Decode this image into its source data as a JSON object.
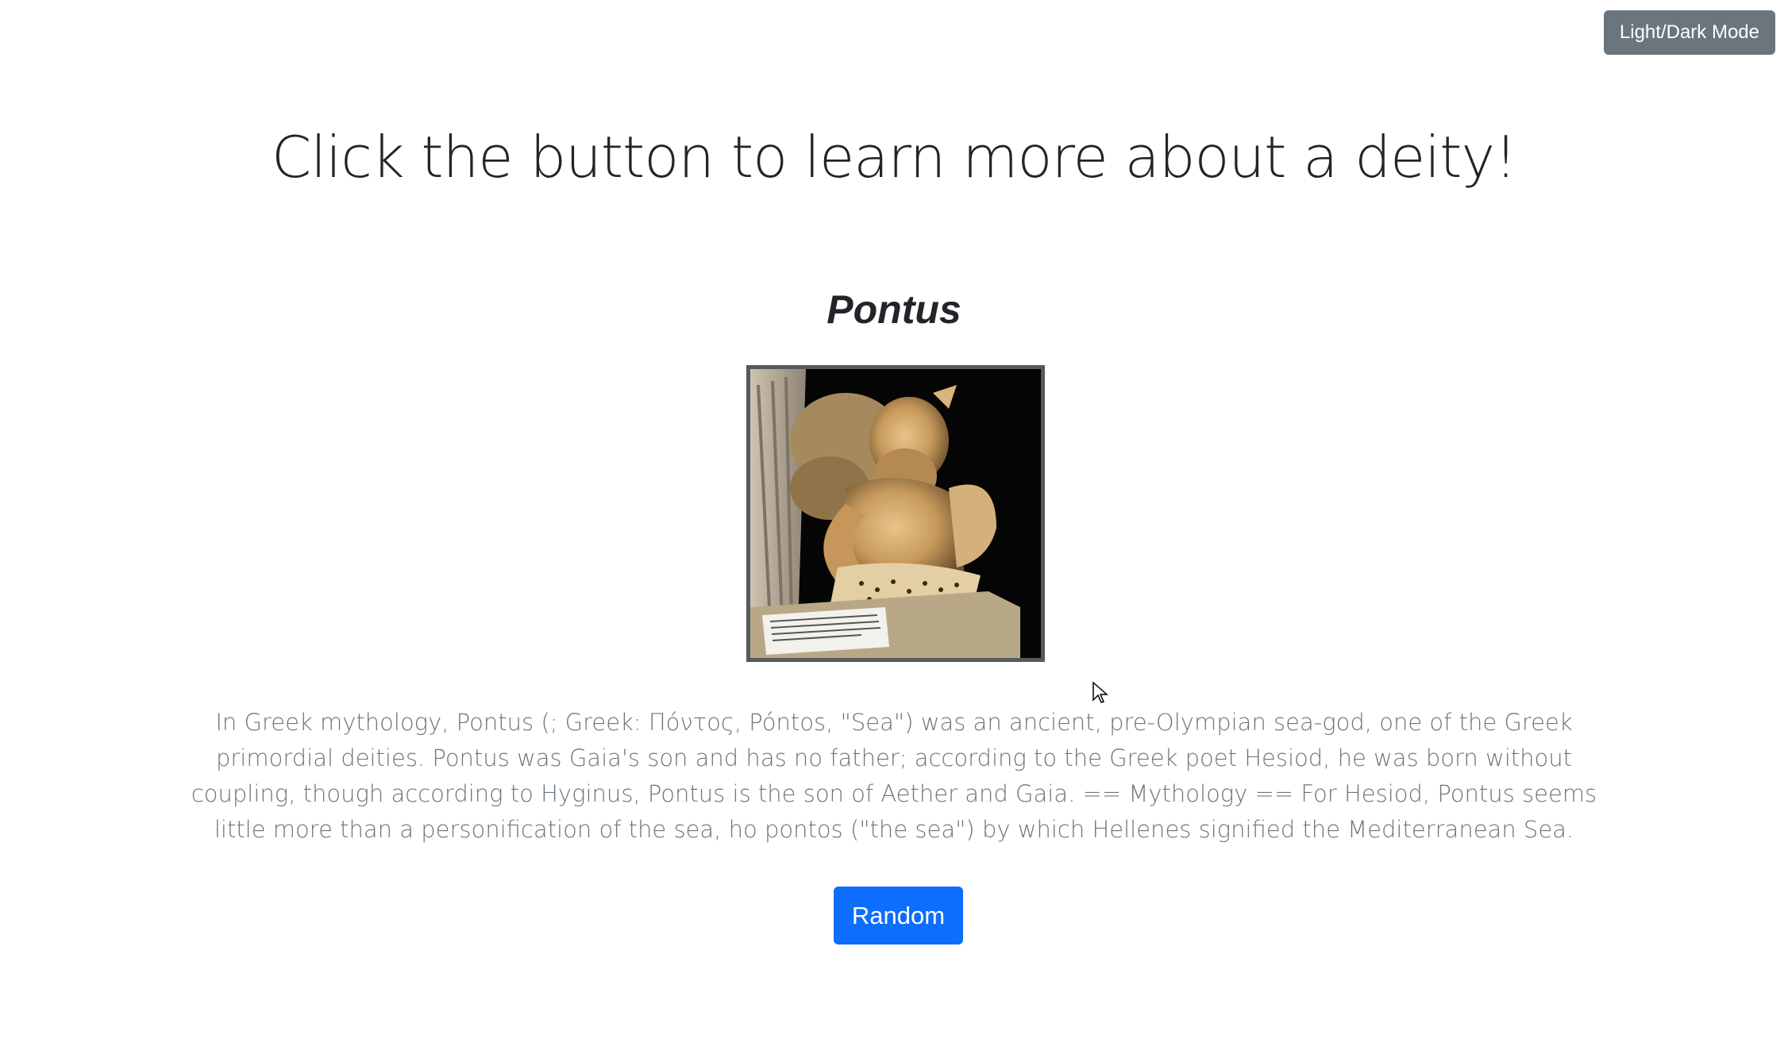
{
  "header": {
    "mode_toggle_label": "Light/Dark Mode"
  },
  "main": {
    "headline": "Click the button to learn more about a deity!",
    "deity_name": "Pontus",
    "description": "In Greek mythology, Pontus (; Greek: Πόντος, Póntos, \"Sea\") was an ancient, pre-Olympian sea-god, one of the Greek primordial deities. Pontus was Gaia's son and has no father; according to the Greek poet Hesiod, he was born without coupling, though according to Hyginus, Pontus is the son of Aether and Gaia. == Mythology == For Hesiod, Pontus seems little more than a personification of the sea, ho pontos (\"the sea\") by which Hellenes signified the Mediterranean Sea.",
    "random_button_label": "Random"
  },
  "colors": {
    "accent": "#0d6efd",
    "secondary_button": "#6c757d",
    "muted_text": "#6c757d",
    "heading_text": "#212529"
  }
}
